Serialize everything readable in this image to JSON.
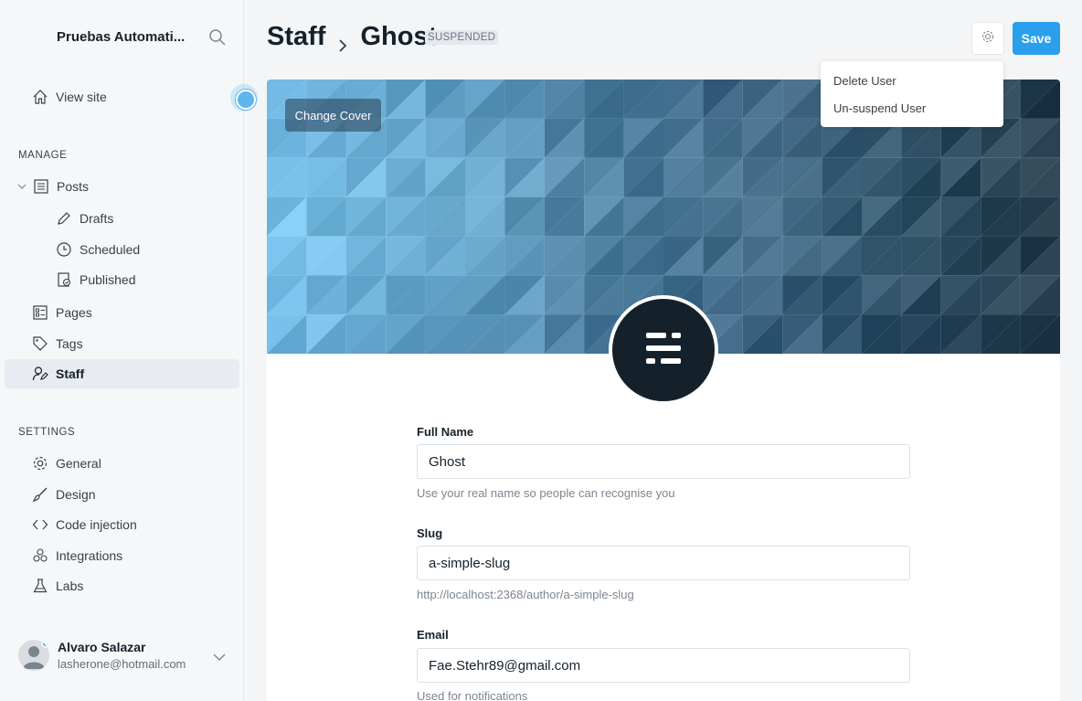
{
  "sidebar": {
    "brand": "Pruebas Automati...",
    "view_site": "View site",
    "manage_heading": "MANAGE",
    "posts": "Posts",
    "drafts": "Drafts",
    "scheduled": "Scheduled",
    "published": "Published",
    "pages": "Pages",
    "tags": "Tags",
    "staff": "Staff",
    "settings_heading": "SETTINGS",
    "general": "General",
    "design": "Design",
    "code_injection": "Code injection",
    "integrations": "Integrations",
    "labs": "Labs"
  },
  "user": {
    "name": "Alvaro Salazar",
    "email": "lasherone@hotmail.com"
  },
  "header": {
    "section": "Staff",
    "current": "Ghost",
    "status_badge": "SUSPENDED",
    "save_label": "Save"
  },
  "cover": {
    "change_label": "Change Cover"
  },
  "dropdown": {
    "delete_user": "Delete User",
    "unsuspend_user": "Un-suspend User"
  },
  "form": {
    "full_name_label": "Full Name",
    "full_name_value": "Ghost",
    "full_name_hint": "Use your real name so people can recognise you",
    "slug_label": "Slug",
    "slug_value": "a-simple-slug",
    "slug_hint": "http://localhost:2368/author/a-simple-slug",
    "email_label": "Email",
    "email_value": "Fae.Stehr89@gmail.com",
    "email_hint": "Used for notifications"
  },
  "colors": {
    "accent": "#2aa0ec",
    "sidebar_active": "#e8ebf1",
    "profile_bg": "#15212a"
  }
}
